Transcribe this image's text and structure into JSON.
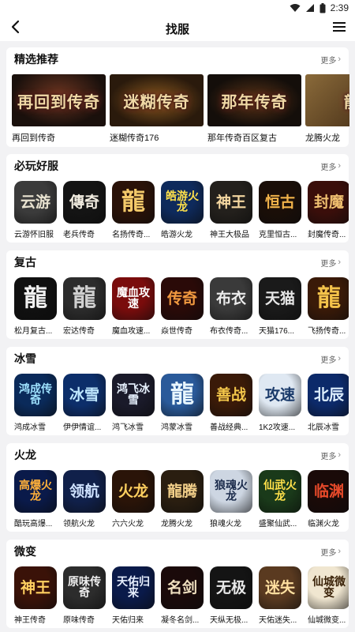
{
  "status_bar": {
    "time": "2:39"
  },
  "header": {
    "title": "找服"
  },
  "more_label": "更多",
  "sections": [
    {
      "title": "精选推荐",
      "items": [
        {
          "name": "再回到传奇",
          "art": "再回到传奇",
          "bg": "#2a1a14"
        },
        {
          "name": "迷糊传奇176",
          "art": "迷糊传奇",
          "bg": "#3a2410"
        },
        {
          "name": "那年传奇百区复古",
          "art": "那年传奇",
          "bg": "#1d1612"
        },
        {
          "name": "龙腾火龙",
          "art": "龍",
          "bg": "#5a3a1a"
        }
      ]
    },
    {
      "title": "必玩好服",
      "items": [
        {
          "name": "云游怀旧服",
          "art": "云游",
          "bg": "#3b3b3b",
          "fg": "#e8e2d0"
        },
        {
          "name": "老兵传奇",
          "art": "傳奇",
          "bg": "#141414",
          "fg": "#f1ece0"
        },
        {
          "name": "名扬传奇...",
          "art": "龍",
          "bg": "#2a1208",
          "fg": "#f3c96a"
        },
        {
          "name": "皓游火龙",
          "art": "皓游火龙",
          "bg": "#0e2a5c",
          "fg": "#ffe14a"
        },
        {
          "name": "神王大极品",
          "art": "神王",
          "bg": "#23201c",
          "fg": "#f4d7a0"
        },
        {
          "name": "克里恒古...",
          "art": "恒古",
          "bg": "#1a0e08",
          "fg": "#f0b24a"
        },
        {
          "name": "封魔传奇...",
          "art": "封魔",
          "bg": "#3a0e0a",
          "fg": "#f0c070"
        }
      ]
    },
    {
      "title": "复古",
      "items": [
        {
          "name": "松月复古...",
          "art": "龍",
          "bg": "#101010",
          "fg": "#f0f0f0"
        },
        {
          "name": "宏达传奇",
          "art": "龍",
          "bg": "#2c2c2c",
          "fg": "#cfcfcf"
        },
        {
          "name": "魔血攻速...",
          "art": "魔血攻速",
          "bg": "#7a0c0c",
          "fg": "#ffffff"
        },
        {
          "name": "焱世传奇",
          "art": "传奇",
          "bg": "#2a0a08",
          "fg": "#f29a40"
        },
        {
          "name": "布衣传奇...",
          "art": "布衣",
          "bg": "#3a3a3a",
          "fg": "#ececec"
        },
        {
          "name": "天猫176...",
          "art": "天猫",
          "bg": "#1a1a1a",
          "fg": "#e6e6e6"
        },
        {
          "name": "飞扬传奇...",
          "art": "龍",
          "bg": "#3a1a08",
          "fg": "#f3c24a"
        }
      ]
    },
    {
      "title": "冰雪",
      "items": [
        {
          "name": "鸿成冰雪",
          "art": "鸿成传奇",
          "bg": "#0a2a5a",
          "fg": "#9fe3ff"
        },
        {
          "name": "伊伊情谊...",
          "art": "冰雪",
          "bg": "#0c2e6a",
          "fg": "#bfe8ff"
        },
        {
          "name": "鸿飞冰雪",
          "art": "鸿飞冰雪",
          "bg": "#1a1a2a",
          "fg": "#e8f2ff"
        },
        {
          "name": "鸿蒙冰雪",
          "art": "龍",
          "bg": "#2a5a9a",
          "fg": "#e8f6ff"
        },
        {
          "name": "善战经典...",
          "art": "善战",
          "bg": "#3a1a08",
          "fg": "#f3c64a"
        },
        {
          "name": "1K2攻速...",
          "art": "攻速",
          "bg": "#dfe8f2",
          "fg": "#1a3a6a"
        },
        {
          "name": "北辰冰雪",
          "art": "北辰",
          "bg": "#0c2a6a",
          "fg": "#dff0ff"
        }
      ]
    },
    {
      "title": "火龙",
      "items": [
        {
          "name": "酷玩高爆...",
          "art": "高爆火龙",
          "bg": "#0a1a4a",
          "fg": "#ffb03a"
        },
        {
          "name": "领航火龙",
          "art": "领航",
          "bg": "#10204a",
          "fg": "#cfe2ff"
        },
        {
          "name": "六六火龙",
          "art": "火龙",
          "bg": "#2a1408",
          "fg": "#ffd060"
        },
        {
          "name": "龙腾火龙",
          "art": "龍腾",
          "bg": "#2a1e10",
          "fg": "#f3d08a"
        },
        {
          "name": "狼魂火龙",
          "art": "狼魂火龙",
          "bg": "#cdd6e2",
          "fg": "#1a2a4a"
        },
        {
          "name": "盛聚仙武...",
          "art": "仙武火龙",
          "bg": "#1a3a1a",
          "fg": "#ffe04a"
        },
        {
          "name": "临渊火龙",
          "art": "临渊",
          "bg": "#1a0a08",
          "fg": "#e84a2a"
        }
      ]
    },
    {
      "title": "微变",
      "items": [
        {
          "name": "神王传奇",
          "art": "神王",
          "bg": "#3a1208",
          "fg": "#ffd060"
        },
        {
          "name": "原味传奇",
          "art": "原味传奇",
          "bg": "#2c2c2c",
          "fg": "#f0f0f0"
        },
        {
          "name": "天佑归来",
          "art": "天佑归来",
          "bg": "#0a1a4a",
          "fg": "#e8f0ff"
        },
        {
          "name": "凝冬名剑...",
          "art": "名剑",
          "bg": "#1a0a0a",
          "fg": "#f0e0c0"
        },
        {
          "name": "天纵无极...",
          "art": "无极",
          "bg": "#141414",
          "fg": "#e8e8e8"
        },
        {
          "name": "天佑迷失...",
          "art": "迷失",
          "bg": "#5a3a20",
          "fg": "#ffe0a0"
        },
        {
          "name": "仙城微变...",
          "art": "仙城微变",
          "bg": "#f0e6d0",
          "fg": "#3a2208"
        }
      ]
    }
  ]
}
